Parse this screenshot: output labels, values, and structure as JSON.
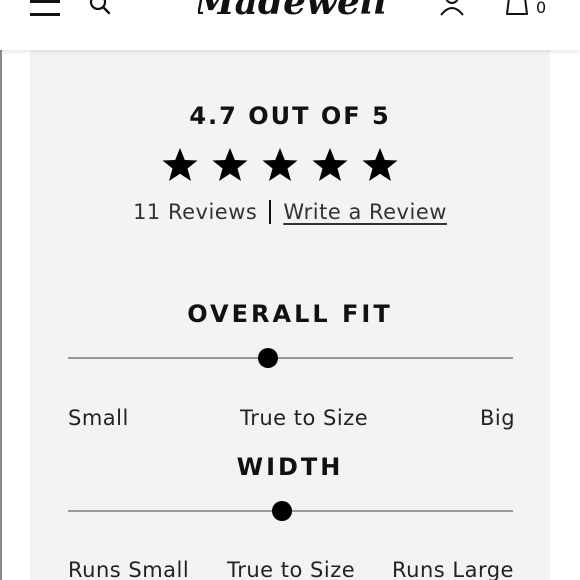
{
  "header": {
    "brand": "Madewell",
    "cart_count": "0",
    "icons": [
      "menu-icon",
      "search-icon",
      "user-icon",
      "shopping-bag-icon"
    ]
  },
  "rating": {
    "heading": "4.7 OUT OF 5",
    "stars_filled": 5,
    "stars_total": 5,
    "reviews_count_text": "11 Reviews",
    "write_review_label": "Write a Review"
  },
  "overall_fit": {
    "title": "OVERALL FIT",
    "marker_position": 0.45,
    "labels": [
      "Small",
      "True to Size",
      "Big"
    ]
  },
  "width": {
    "title": "WIDTH",
    "marker_position": 0.48,
    "labels": [
      "Runs Small",
      "True to Size",
      "Runs Large"
    ]
  },
  "colors": {
    "panel_background": "#f3f3f3",
    "track": "#999999",
    "marker": "#000000",
    "text": "#111111"
  }
}
